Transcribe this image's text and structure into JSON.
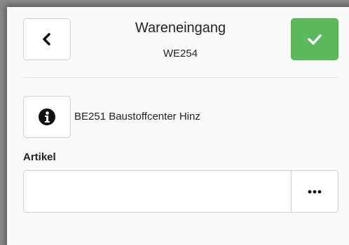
{
  "header": {
    "title": "Wareneingang",
    "subtitle": "WE254",
    "back_icon": "chevron-left-icon",
    "confirm_icon": "check-icon",
    "confirm_color": "#5cb85c"
  },
  "supplier": {
    "icon": "info-circle-icon",
    "text": "BE251 Baustoffcenter Hinz"
  },
  "article": {
    "label": "Artikel",
    "value": "",
    "placeholder": "",
    "more_icon": "ellipsis-icon"
  }
}
